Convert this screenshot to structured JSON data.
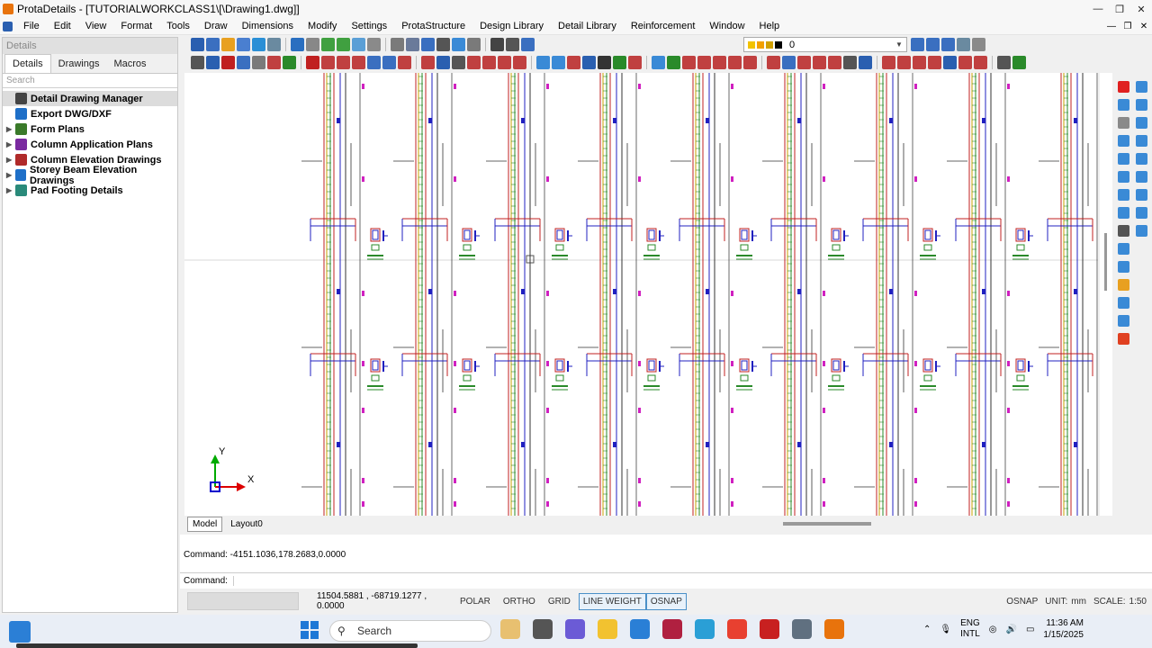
{
  "window": {
    "title": "ProtaDetails - [TUTORIALWORKCLASS1\\[\\Drawing1.dwg]]"
  },
  "menu": [
    "File",
    "Edit",
    "View",
    "Format",
    "Tools",
    "Draw",
    "Dimensions",
    "Modify",
    "Settings",
    "ProtaStructure",
    "Design Library",
    "Detail Library",
    "Reinforcement",
    "Window",
    "Help"
  ],
  "toolbar": {
    "layer_value": "0"
  },
  "panel": {
    "header": "Details",
    "tabs": [
      "Details",
      "Drawings",
      "Macros"
    ],
    "search_placeholder": "Search",
    "tree": [
      {
        "label": "Detail Drawing Manager",
        "icon": "manager-icon",
        "color": "#222222"
      },
      {
        "label": "Export DWG/DXF",
        "icon": "export-icon",
        "color": "#1e6fc8"
      },
      {
        "label": "Form Plans",
        "icon": "form-plan-icon",
        "color": "#3a7a2a"
      },
      {
        "label": "Column Application Plans",
        "icon": "column-plan-icon",
        "color": "#7a2aa0"
      },
      {
        "label": "Column Elevation Drawings",
        "icon": "column-elevation-icon",
        "color": "#b02a2a"
      },
      {
        "label": "Storey Beam Elevation Drawings",
        "icon": "beam-elevation-icon",
        "color": "#1e6fc8"
      },
      {
        "label": "Pad Footing Details",
        "icon": "footing-icon",
        "color": "#2a8a7a"
      }
    ]
  },
  "canvas": {
    "axis_x": "X",
    "axis_y": "Y"
  },
  "layout_tabs": [
    "Model",
    "Layout0"
  ],
  "command": {
    "history": "Command: -4151.1036,178.2683,0.0000",
    "prompt": "Command:"
  },
  "status": {
    "coords": "11504.5881 , -68719.1277 , 0.0000",
    "buttons": [
      {
        "label": "POLAR",
        "on": false
      },
      {
        "label": "ORTHO",
        "on": false
      },
      {
        "label": "GRID",
        "on": false
      },
      {
        "label": "LINE WEIGHT",
        "on": true
      },
      {
        "label": "OSNAP",
        "on": true
      }
    ],
    "right": {
      "osnap": "OSNAP",
      "unit": "UNIT:",
      "unit_value": "mm",
      "scale": "SCALE:",
      "scale_value": "1:50"
    }
  },
  "taskbar": {
    "search": "Search",
    "language": "ENG",
    "layout": "INTL",
    "time": "11:36 AM",
    "date": "1/15/2025"
  }
}
